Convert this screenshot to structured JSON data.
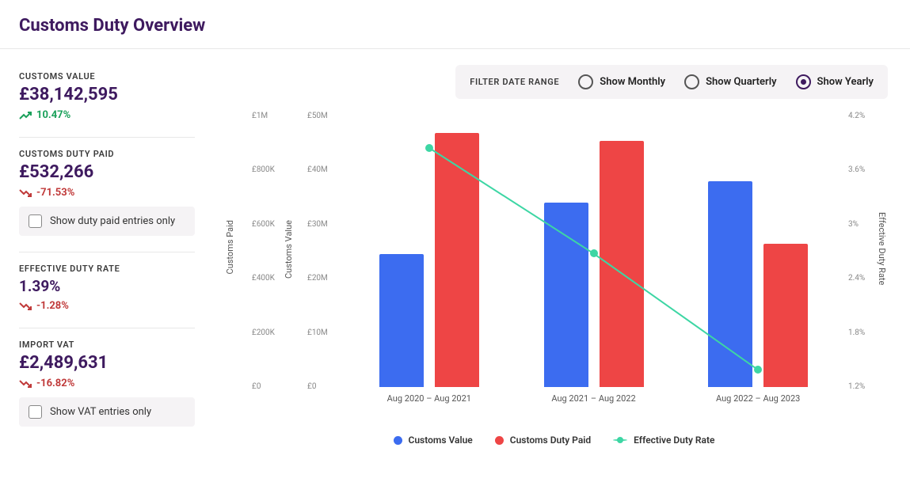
{
  "header": {
    "title": "Customs Duty Overview"
  },
  "metrics": [
    {
      "label": "CUSTOMS VALUE",
      "value": "£38,142,595",
      "delta": "10.47%",
      "dir": "up"
    },
    {
      "label": "CUSTOMS DUTY PAID",
      "value": "£532,266",
      "delta": "-71.53%",
      "dir": "down",
      "filter": "Show duty paid entries only"
    },
    {
      "label": "EFFECTIVE DUTY RATE",
      "value": "1.39%",
      "delta": "-1.28%",
      "dir": "down",
      "small": true
    },
    {
      "label": "IMPORT VAT",
      "value": "£2,489,631",
      "delta": "-16.82%",
      "dir": "down",
      "filter": "Show VAT entries only"
    }
  ],
  "filter_bar": {
    "label": "FILTER DATE RANGE",
    "options": [
      "Show Monthly",
      "Show Quarterly",
      "Show Yearly"
    ],
    "selected": 2
  },
  "chart_data": {
    "type": "bar+line",
    "categories": [
      "Aug 2020 – Aug 2021",
      "Aug 2021 – Aug 2022",
      "Aug 2022 – Aug 2023"
    ],
    "axes": {
      "left1": {
        "label": "Customs Paid",
        "ticks": [
          "£0",
          "£200K",
          "£400K",
          "£600K",
          "£800K",
          "£1M"
        ],
        "range": [
          0,
          1000000
        ]
      },
      "left2": {
        "label": "Customs Value",
        "ticks": [
          "£0",
          "£10M",
          "£20M",
          "£30M",
          "£40M",
          "£50M"
        ],
        "range": [
          0,
          50000000
        ]
      },
      "right": {
        "label": "Effective Duty Rate",
        "ticks": [
          "1.2%",
          "1.8%",
          "2.4%",
          "3%",
          "3.6%",
          "4.2%"
        ],
        "range": [
          1.2,
          4.2
        ]
      }
    },
    "series": [
      {
        "name": "Customs Value",
        "kind": "bar",
        "axis": "left2",
        "color": "#3c6cf0",
        "values": [
          24500000,
          34000000,
          38000000
        ]
      },
      {
        "name": "Customs Duty Paid",
        "kind": "bar",
        "axis": "left1",
        "color": "#ee4545",
        "values": [
          940000,
          910000,
          530000
        ]
      },
      {
        "name": "Effective Duty Rate",
        "kind": "line",
        "axis": "right",
        "color": "#3dd6a4",
        "values": [
          3.85,
          2.68,
          1.39
        ]
      }
    ],
    "legend": [
      "Customs Value",
      "Customs Duty Paid",
      "Effective Duty Rate"
    ]
  }
}
